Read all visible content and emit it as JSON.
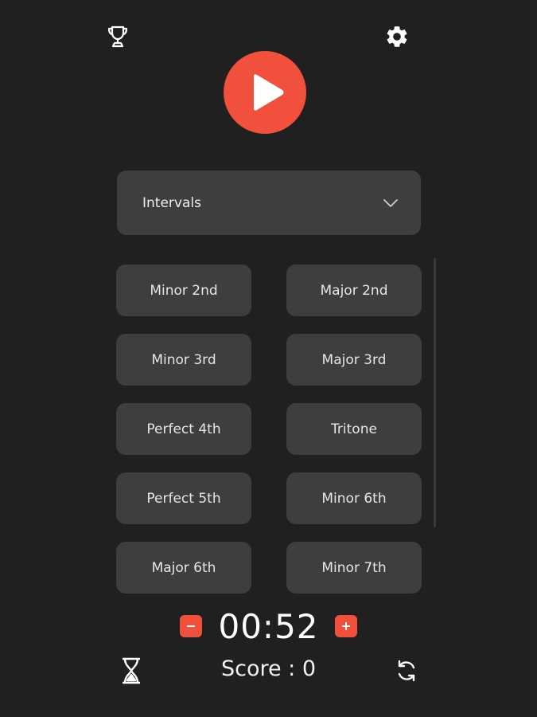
{
  "icons": {
    "trophy": "trophy-icon",
    "settings": "gear-icon",
    "play": "play-icon",
    "dropdown_arrow": "chevron-down-icon",
    "decrease": "minus-icon",
    "increase": "plus-icon",
    "timer_mode": "hourglass-icon",
    "reset": "refresh-icon"
  },
  "colors": {
    "background": "#202020",
    "accent": "#f0503c",
    "tile": "#3e3e3e"
  },
  "dropdown": {
    "selected": "Intervals"
  },
  "options": [
    "Minor 2nd",
    "Major 2nd",
    "Minor 3rd",
    "Major 3rd",
    "Perfect 4th",
    "Tritone",
    "Perfect 5th",
    "Minor 6th",
    "Major 6th",
    "Minor 7th"
  ],
  "timer": {
    "value": "00:52"
  },
  "score": {
    "text": "Score : 0"
  }
}
